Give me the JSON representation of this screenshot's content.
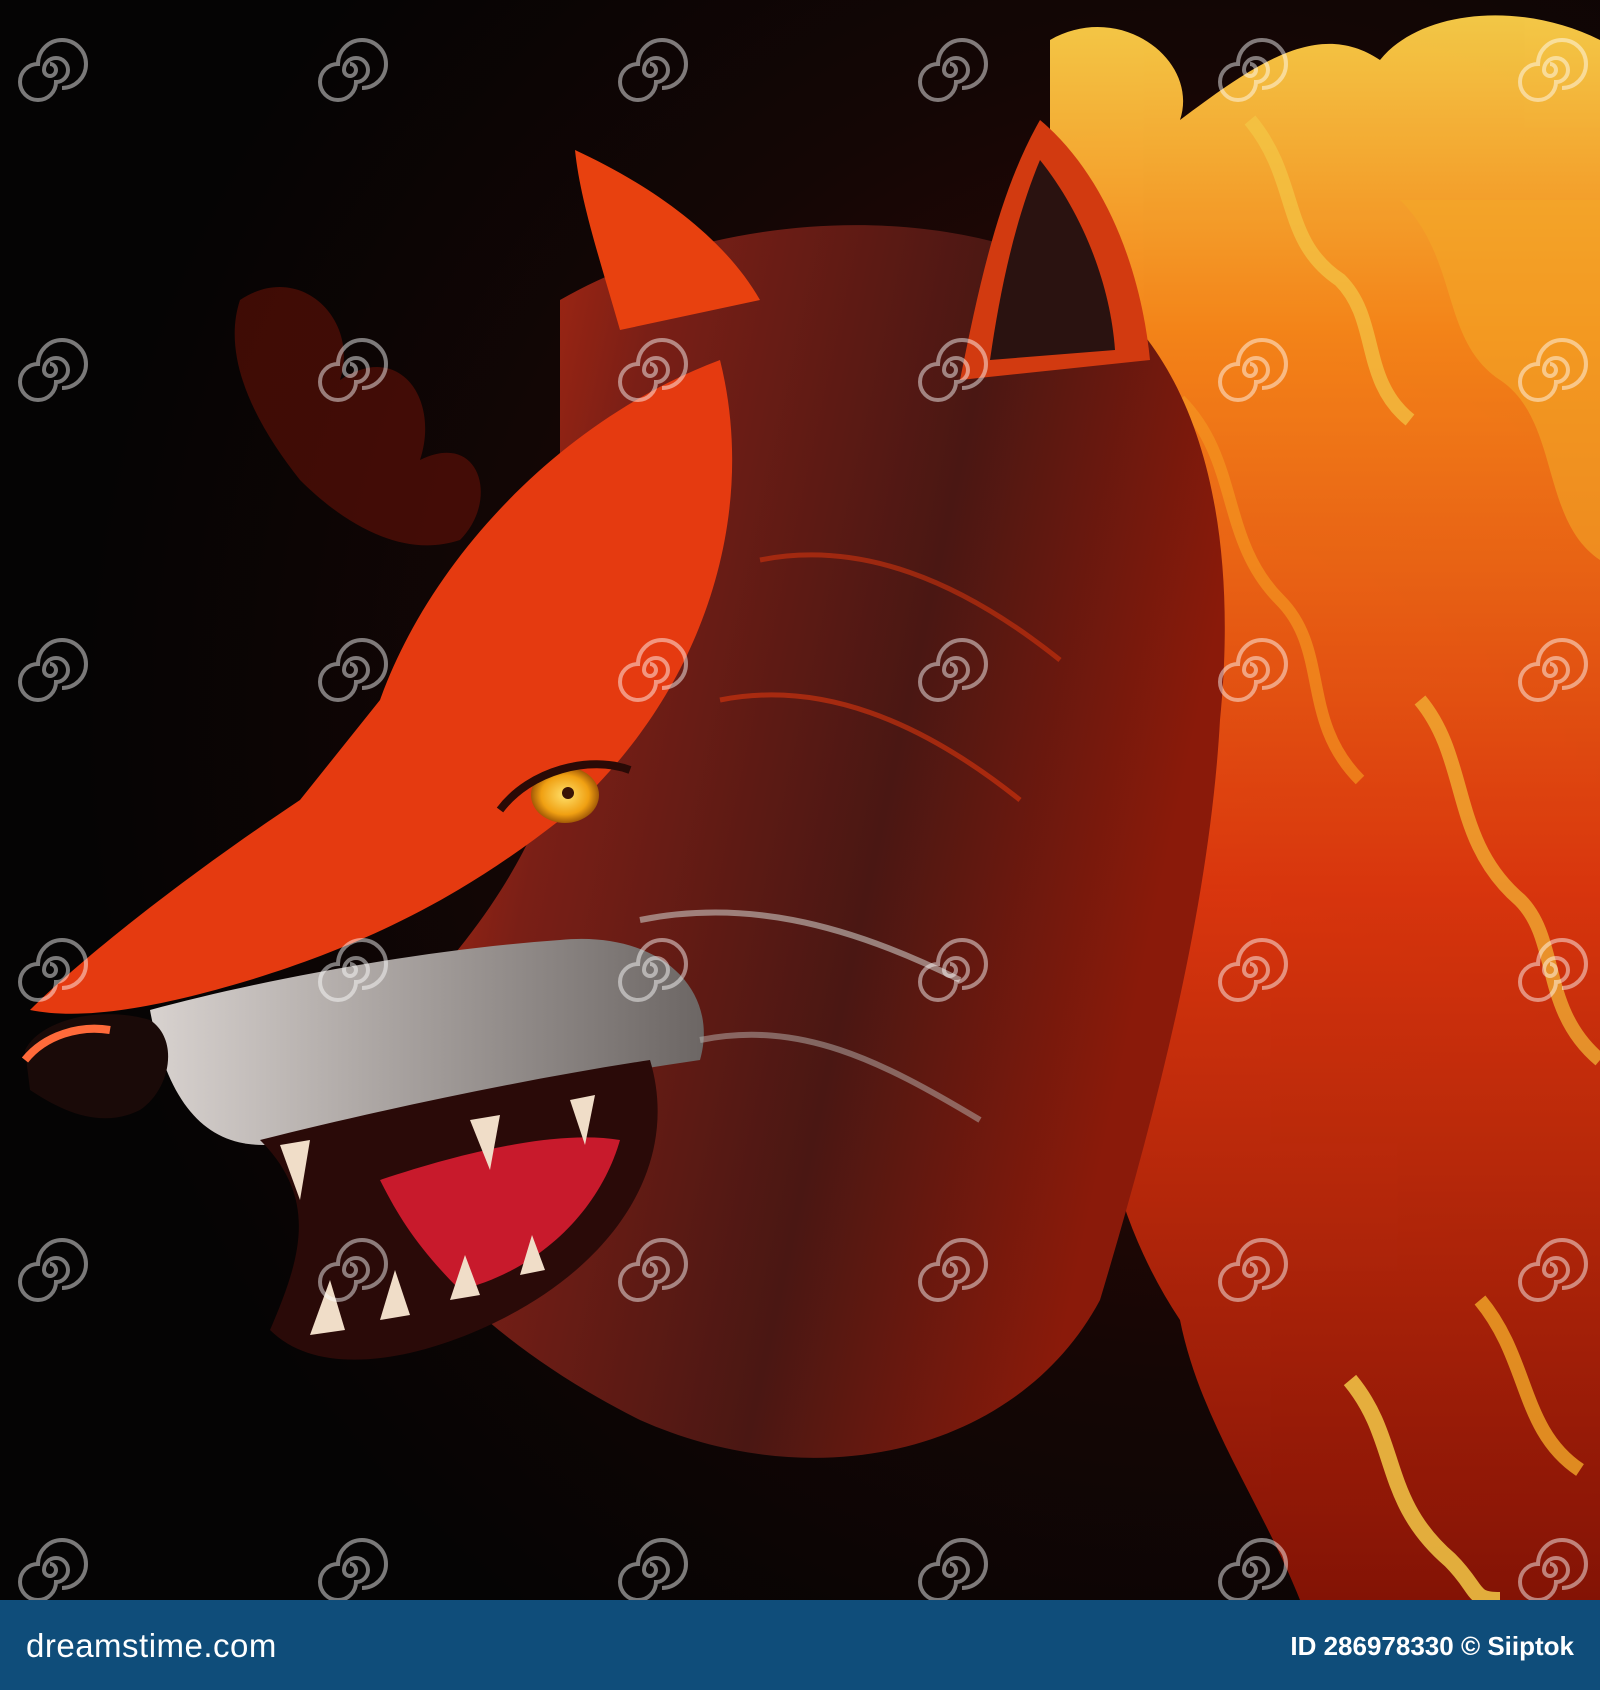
{
  "image": {
    "subject": "fire-wolf-head-icon",
    "palette": {
      "background": "#080606",
      "flame_deep": "#8a1406",
      "flame_mid": "#e2380e",
      "flame_bright": "#ff8a1a",
      "flame_hot": "#ffd24a",
      "fur_dark": "#4a1a16",
      "muzzle": "#b9b3b0",
      "eye": "#f4b21a",
      "footer": "#0f4d7a"
    }
  },
  "watermark": {
    "text": "dreamstime",
    "icon": "swirl-logo-icon"
  },
  "footer": {
    "brand": "dreamstime.com",
    "credit": "ID 286978330 © Siiptok"
  }
}
